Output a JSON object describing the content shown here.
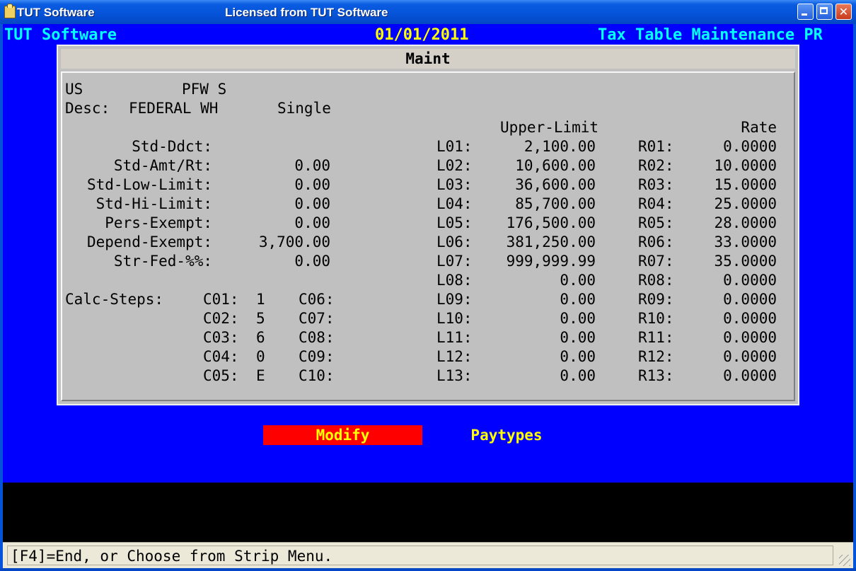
{
  "window": {
    "app_title": "TUT Software",
    "license_title": "Licensed from TUT Software",
    "buttons": {
      "minimize": "minimize",
      "maximize": "maximize",
      "close": "✕"
    }
  },
  "header": {
    "left": "TUT Software",
    "date": "01/01/2011",
    "right": "Tax Table Maintenance PR"
  },
  "panel": {
    "title": "Maint",
    "jurisdiction": "US",
    "code": "PFW S",
    "desc_label": "Desc:",
    "desc_value": "FEDERAL WH",
    "filing_status": "Single",
    "col_upper_limit": "Upper-Limit",
    "col_rate": "Rate",
    "fields": [
      {
        "label": "Std-Ddct:",
        "value": ""
      },
      {
        "label": "Std-Amt/Rt:",
        "value": "0.00"
      },
      {
        "label": "Std-Low-Limit:",
        "value": "0.00"
      },
      {
        "label": "Std-Hi-Limit:",
        "value": "0.00"
      },
      {
        "label": "Pers-Exempt:",
        "value": "0.00"
      },
      {
        "label": "Depend-Exempt:",
        "value": "3,700.00"
      },
      {
        "label": "Str-Fed-%%:",
        "value": "0.00"
      }
    ],
    "brackets": [
      {
        "l": "L01:",
        "limit": "2,100.00",
        "r": "R01:",
        "rate": "0.0000"
      },
      {
        "l": "L02:",
        "limit": "10,600.00",
        "r": "R02:",
        "rate": "10.0000"
      },
      {
        "l": "L03:",
        "limit": "36,600.00",
        "r": "R03:",
        "rate": "15.0000"
      },
      {
        "l": "L04:",
        "limit": "85,700.00",
        "r": "R04:",
        "rate": "25.0000"
      },
      {
        "l": "L05:",
        "limit": "176,500.00",
        "r": "R05:",
        "rate": "28.0000"
      },
      {
        "l": "L06:",
        "limit": "381,250.00",
        "r": "R06:",
        "rate": "33.0000"
      },
      {
        "l": "L07:",
        "limit": "999,999.99",
        "r": "R07:",
        "rate": "35.0000"
      },
      {
        "l": "L08:",
        "limit": "0.00",
        "r": "R08:",
        "rate": "0.0000"
      },
      {
        "l": "L09:",
        "limit": "0.00",
        "r": "R09:",
        "rate": "0.0000"
      },
      {
        "l": "L10:",
        "limit": "0.00",
        "r": "R10:",
        "rate": "0.0000"
      },
      {
        "l": "L11:",
        "limit": "0.00",
        "r": "R11:",
        "rate": "0.0000"
      },
      {
        "l": "L12:",
        "limit": "0.00",
        "r": "R12:",
        "rate": "0.0000"
      },
      {
        "l": "L13:",
        "limit": "0.00",
        "r": "R13:",
        "rate": "0.0000"
      }
    ],
    "calc_label": "Calc-Steps:",
    "calc_steps_a": [
      {
        "label": "C01:",
        "value": "1"
      },
      {
        "label": "C02:",
        "value": "5"
      },
      {
        "label": "C03:",
        "value": "6"
      },
      {
        "label": "C04:",
        "value": "0"
      },
      {
        "label": "C05:",
        "value": "E"
      }
    ],
    "calc_steps_b": [
      {
        "label": "C06:",
        "value": ""
      },
      {
        "label": "C07:",
        "value": ""
      },
      {
        "label": "C08:",
        "value": ""
      },
      {
        "label": "C09:",
        "value": ""
      },
      {
        "label": "C10:",
        "value": ""
      }
    ]
  },
  "menu": {
    "modify": "Modify",
    "paytypes": "Paytypes"
  },
  "status": {
    "text": "[F4]=End, or Choose from Strip Menu."
  },
  "colors": {
    "screen_bg": "#0000ff",
    "header_text": "#00ffff",
    "date_text": "#ffff00",
    "panel_bg": "#c0c0c0",
    "menu_selected_bg": "#ff0000",
    "menu_text": "#ffff00"
  }
}
